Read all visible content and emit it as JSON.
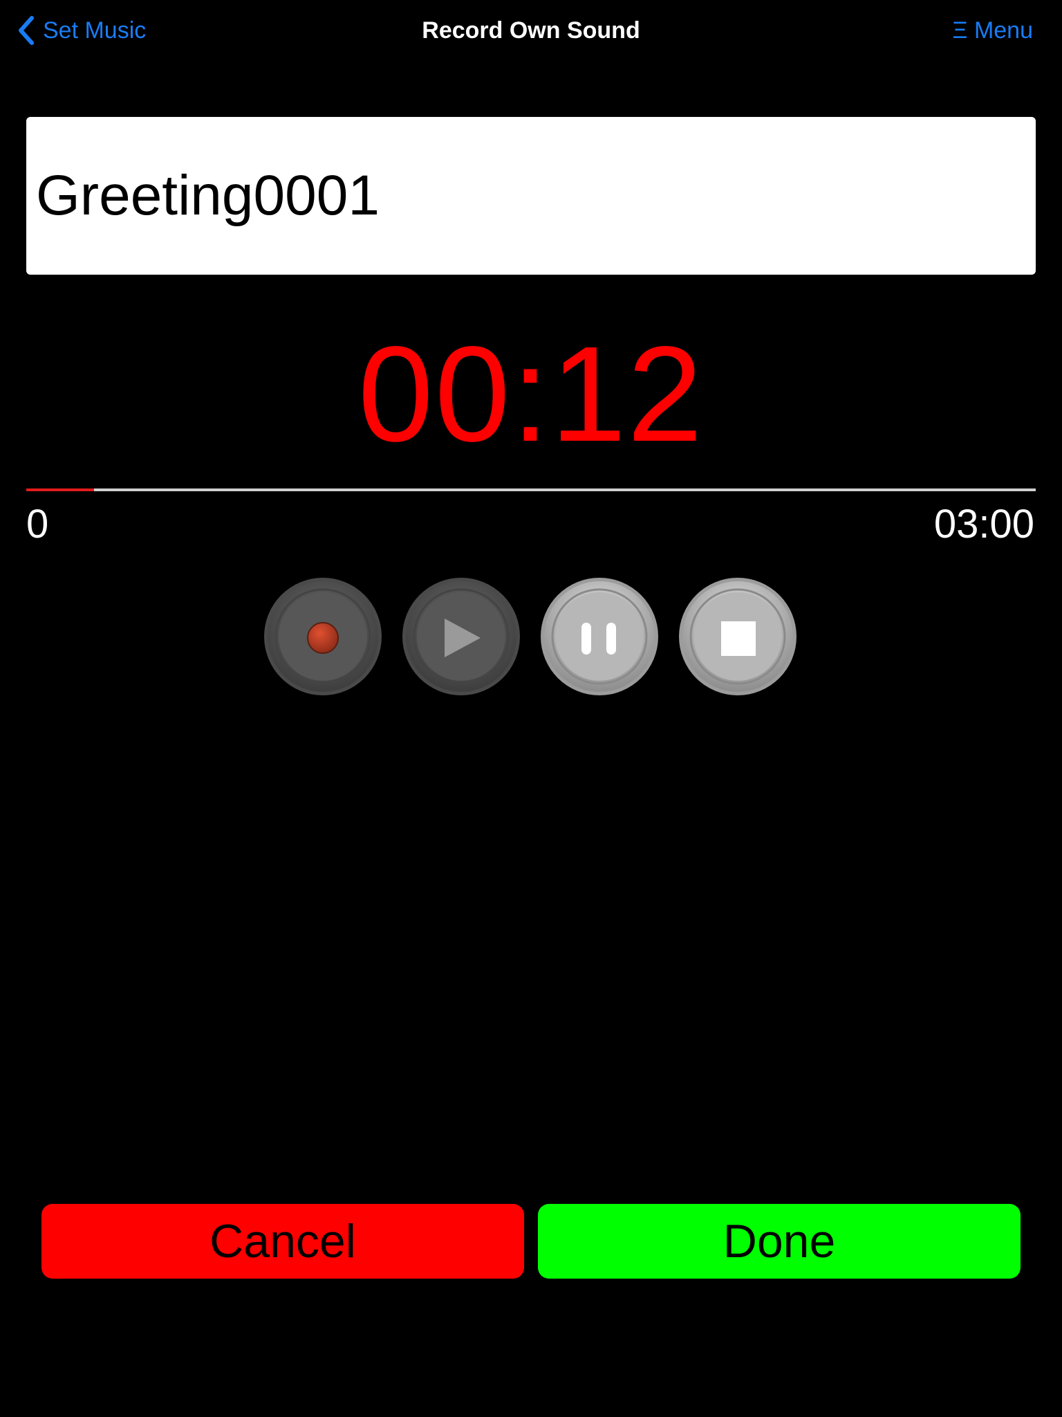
{
  "nav": {
    "back_label": "Set Music",
    "title": "Record Own Sound",
    "menu_label": "Ξ Menu"
  },
  "recording": {
    "name": "Greeting0001",
    "elapsed": "00:12",
    "progress_fraction": 0.067,
    "range_start": "0",
    "range_end": "03:00"
  },
  "controls": [
    {
      "name": "record",
      "icon": "record-icon",
      "enabled": false
    },
    {
      "name": "play",
      "icon": "play-icon",
      "enabled": false
    },
    {
      "name": "pause",
      "icon": "pause-icon",
      "enabled": true
    },
    {
      "name": "stop",
      "icon": "stop-icon",
      "enabled": true
    }
  ],
  "actions": {
    "cancel_label": "Cancel",
    "done_label": "Done"
  },
  "colors": {
    "link": "#1a7cf5",
    "timer": "#ff0000",
    "progress_fill": "#e31b1b",
    "cancel": "#ff0000",
    "done": "#00ff00"
  }
}
